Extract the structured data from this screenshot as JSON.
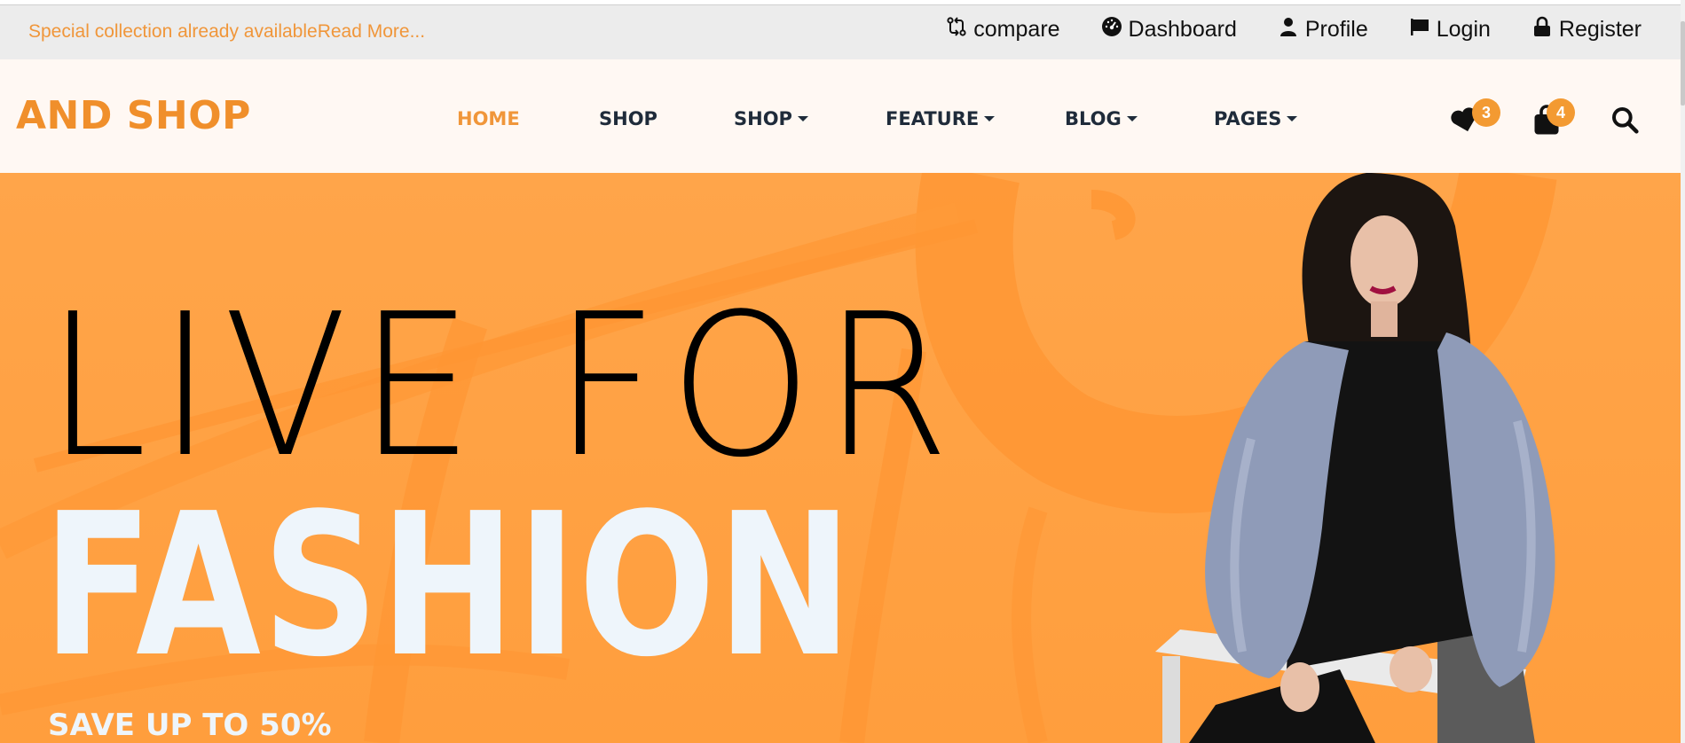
{
  "topbar": {
    "promo_text": "Special collection already available",
    "promo_link": "Read More...",
    "links": [
      {
        "label": "compare",
        "icon": "compare-icon"
      },
      {
        "label": "Dashboard",
        "icon": "dashboard-gauge-icon"
      },
      {
        "label": "Profile",
        "icon": "user-icon"
      },
      {
        "label": "Login",
        "icon": "login-flag-icon"
      },
      {
        "label": "Register",
        "icon": "lock-icon"
      }
    ]
  },
  "nav": {
    "logo": "AND SHOP",
    "menu": [
      {
        "label": "HOME",
        "active": true,
        "dropdown": false
      },
      {
        "label": "SHOP",
        "active": false,
        "dropdown": false
      },
      {
        "label": "SHOP",
        "active": false,
        "dropdown": true
      },
      {
        "label": "FEATURE",
        "active": false,
        "dropdown": true
      },
      {
        "label": "BLOG",
        "active": false,
        "dropdown": true
      },
      {
        "label": "PAGES",
        "active": false,
        "dropdown": true
      }
    ],
    "wishlist_count": "3",
    "cart_count": "4"
  },
  "hero": {
    "line1": "LIVE FOR",
    "line2": "FASHION",
    "line3": "SAVE UP TO 50%"
  },
  "colors": {
    "accent": "#f0963a",
    "hero_bg": "#ffa54a",
    "nav_text": "#1f2b3a",
    "hero_text_light": "#eef5fb"
  }
}
